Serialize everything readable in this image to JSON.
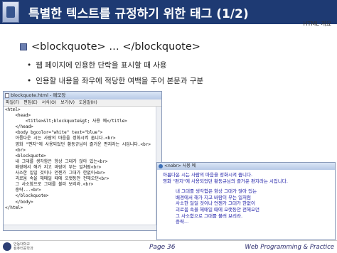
{
  "slide": {
    "title": "특별한 텍스트를 규정하기 위한 태그 (1/2)",
    "subtag": "HTML 개요",
    "section_heading": "<blockquote> … </blockquote>",
    "bullets": [
      "웹 페이지에 인용한 단락을 표시할 때 사용",
      "인용할 내용을 좌우에 적당한 여백을 주어 본문과 구분"
    ]
  },
  "notepad": {
    "title": "blockquote.html - 메모장",
    "menu": [
      "파일(F)",
      "편집(E)",
      "서식(O)",
      "보기(V)",
      "도움말(H)"
    ],
    "lines": [
      "<html>",
      "    <head>",
      "        <title>&lt;blockquote&gt; 사용 예</title>",
      "    </head>",
      "    <body bgcolor=\"white\" text=\"blue\">",
      "    아름다운 시는 사람의 마음을 정화시켜 줍니다.<br>",
      "    영화 \"편지\"에 사용되었던 황동규님의 즐거운 편지라는 시입니다.<br>",
      "    <br>",
      "    <blockquote>",
      "    내 그대를 생각함은 항상 그대가 앉아 있는<br>",
      "    배경에서 해가 지고 바람이 부는 일처럼<br>",
      "    사소한 일일 것이나 언젠가 그대가 한없이<br>",
      "    괴로움 속을 헤매일 때에 오랫동안 전해오던<br>",
      "    그 사소함으로 그대를 불러 보리라.<br>",
      "    중략...<br>",
      "    </blockquote>",
      "    </body>",
      "</html>"
    ]
  },
  "browser": {
    "title": "<nobr> 사용 예",
    "intro": [
      "아름다운 시는 사람의 마음을 정화시켜 줍니다.",
      "영화 \"편지\"에 사용되었던 황동규님의 즐거운 편지라는 시입니다."
    ],
    "quote": [
      "내 그대를 생각함은 항상 그대가 앉아 있는",
      "배경에서 해가 지고 바람이 부는 일처럼",
      "사소한 일일 것이나 언젠가 그대가 한없이",
      "괴로움 속을 헤매일 때에 오랫동안 전해오던",
      "그 사소함으로 그대를 불러 보리라.",
      "중략..."
    ]
  },
  "footer": {
    "school_line1": "안동대학교",
    "school_line2": "컴퓨터공학과",
    "page": "Page 36",
    "course": "Web Programming & Practice"
  }
}
